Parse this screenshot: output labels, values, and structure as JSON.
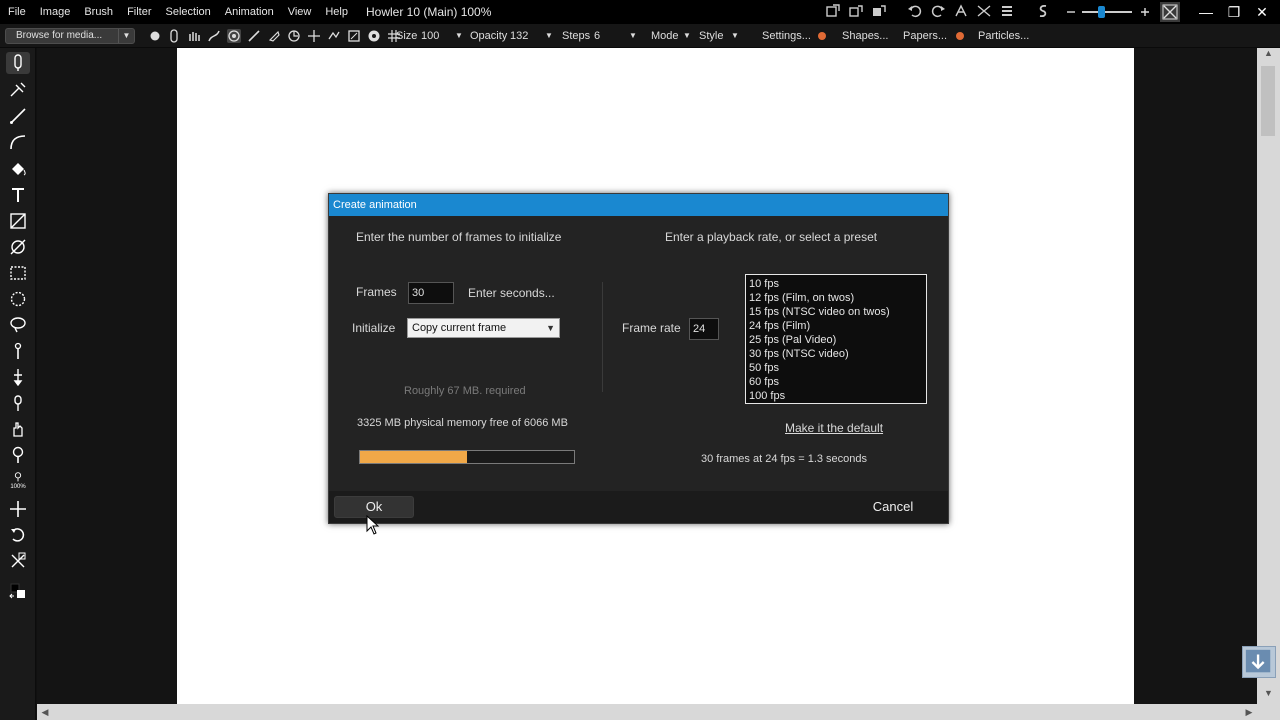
{
  "menubar": {
    "items": [
      "File",
      "Image",
      "Brush",
      "Filter",
      "Selection",
      "Animation",
      "View",
      "Help"
    ],
    "title": "Howler 10 (Main)  100%"
  },
  "toolbar": {
    "browse_label": "Browse for media...",
    "size_label": "Size",
    "size_value": "100",
    "opacity_label": "Opacity",
    "opacity_value": "132",
    "steps_label": "Steps",
    "steps_value": "6",
    "mode_label": "Mode",
    "style_label": "Style",
    "settings_label": "Settings...",
    "shapes_label": "Shapes...",
    "papers_label": "Papers...",
    "particles_label": "Particles..."
  },
  "toolbox": {
    "zoom_label": "100%"
  },
  "dialog": {
    "title": "Create animation",
    "frames_heading": "Enter the number of frames to initialize",
    "rate_heading": "Enter a playback rate, or select a preset",
    "frames_label": "Frames",
    "frames_value": "30",
    "enter_seconds_label": "Enter seconds...",
    "initialize_label": "Initialize",
    "initialize_value": "Copy current frame",
    "frame_rate_label": "Frame rate",
    "frame_rate_value": "24",
    "fps_options": [
      "10 fps",
      "12 fps (Film, on twos)",
      "15 fps (NTSC video on twos)",
      "24 fps (Film)",
      "25 fps (Pal Video)",
      "30 fps (NTSC video)",
      "50 fps",
      "60 fps",
      "100 fps"
    ],
    "memory_required": "Roughly 67 MB. required",
    "memory_free": "3325 MB physical memory free of 6066 MB",
    "memory_used_fraction": 0.5,
    "make_default_label": "Make it the default",
    "duration_summary": "30 frames at 24 fps = 1.3 seconds",
    "ok_label": "Ok",
    "cancel_label": "Cancel"
  },
  "colors": {
    "title_bar": "#1a88d0",
    "progress_fill": "#f0a848",
    "accent_orange": "#e06a35"
  }
}
